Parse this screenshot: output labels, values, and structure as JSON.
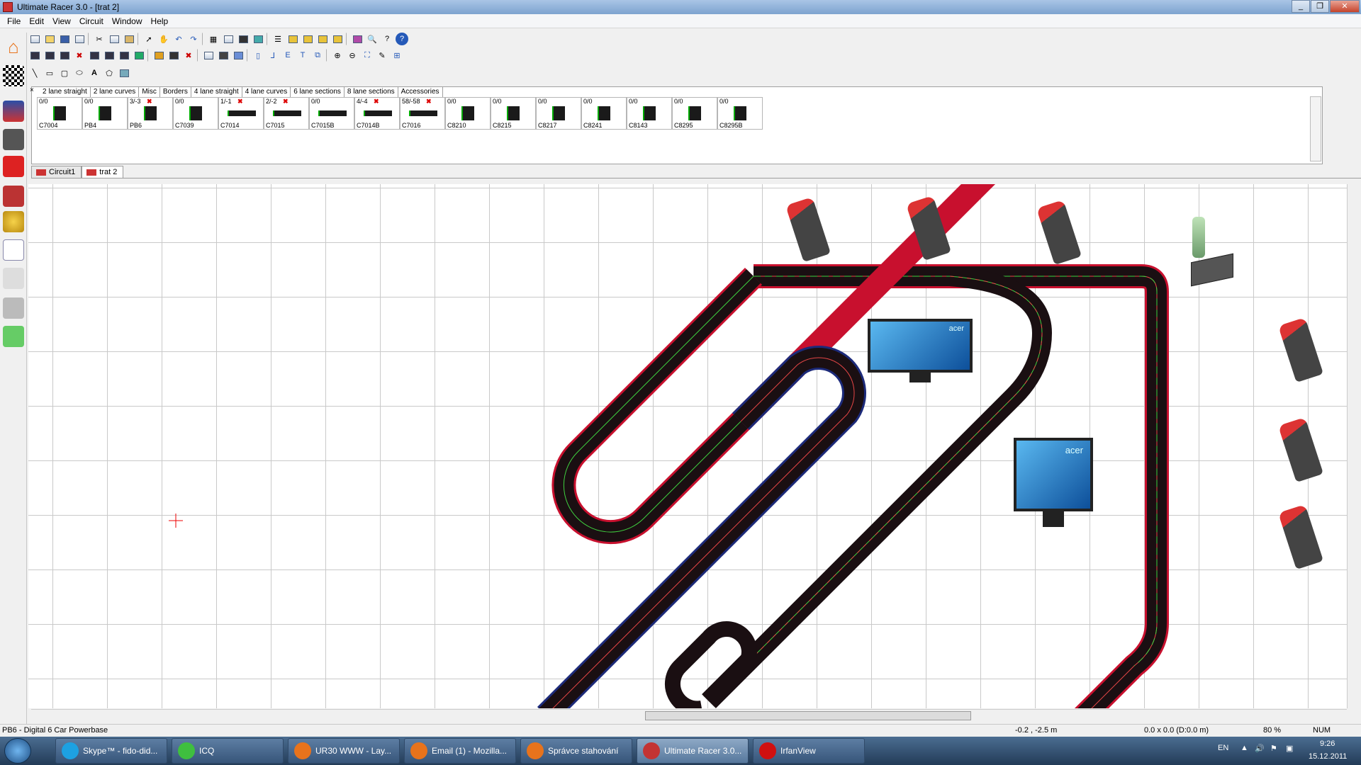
{
  "window": {
    "title": "Ultimate Racer 3.0 - [trat 2]",
    "controls": [
      "_",
      "❐",
      "✕"
    ]
  },
  "menu": [
    "File",
    "Edit",
    "View",
    "Circuit",
    "Window",
    "Help"
  ],
  "palette": {
    "tabs": [
      "2 lane straight",
      "2 lane curves",
      "Misc",
      "Borders",
      "4 lane straight",
      "4 lane curves",
      "6 lane sections",
      "8 lane sections",
      "Accessories"
    ],
    "active_tab": "Misc",
    "pieces": [
      {
        "count": "0/0",
        "code": "C7004"
      },
      {
        "count": "0/0",
        "code": "PB4"
      },
      {
        "count": "3/-3",
        "code": "PB6",
        "over": true
      },
      {
        "count": "0/0",
        "code": "C7039"
      },
      {
        "count": "1/-1",
        "code": "C7014",
        "over": true
      },
      {
        "count": "2/-2",
        "code": "C7015",
        "over": true
      },
      {
        "count": "0/0",
        "code": "C7015B"
      },
      {
        "count": "4/-4",
        "code": "C7014B",
        "over": true
      },
      {
        "count": "58/-58",
        "code": "C7016",
        "over": true
      },
      {
        "count": "0/0",
        "code": "C8210"
      },
      {
        "count": "0/0",
        "code": "C8215"
      },
      {
        "count": "0/0",
        "code": "C8217"
      },
      {
        "count": "0/0",
        "code": "C8241"
      },
      {
        "count": "0/0",
        "code": "C8143"
      },
      {
        "count": "0/0",
        "code": "C8295"
      },
      {
        "count": "0/0",
        "code": "C8295B"
      }
    ]
  },
  "doc_tabs": [
    "Circuit1",
    "trat 2"
  ],
  "active_doc": "trat 2",
  "canvas": {
    "monitor_brand": "acer",
    "track_colors": {
      "surface": "#1a0f12",
      "lane": "#e64646",
      "guide": "#3fd13f",
      "border": "#c8102e",
      "border_alt": "#1c2a7a"
    }
  },
  "status": {
    "message": "PB6 - Digital 6 Car Powerbase",
    "coords": "-0.2 , -2.5 m",
    "size": "0.0 x 0.0  (D:0.0 m)",
    "zoom": "80 %",
    "num": "NUM"
  },
  "taskbar": {
    "items": [
      {
        "label": "Skype™ - fido-did...",
        "color": "#1da1e2"
      },
      {
        "label": "ICQ",
        "color": "#3fbf3f"
      },
      {
        "label": "UR30 WWW - Lay...",
        "color": "#e8731c"
      },
      {
        "label": "Email (1) - Mozilla...",
        "color": "#e8731c"
      },
      {
        "label": "Správce stahování",
        "color": "#e8731c"
      },
      {
        "label": "Ultimate Racer 3.0...",
        "color": "#c33333"
      },
      {
        "label": "IrfanView",
        "color": "#d01010"
      }
    ],
    "active": "Ultimate Racer 3.0...",
    "lang": "EN",
    "time": "9:26",
    "date": "15.12.2011"
  }
}
